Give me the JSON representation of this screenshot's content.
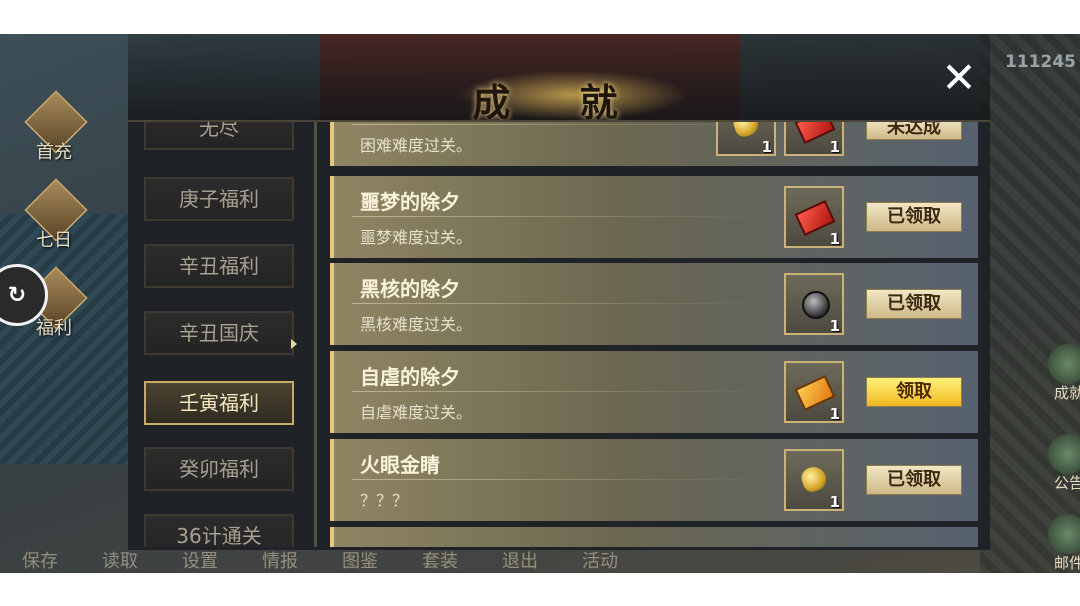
{
  "dialog": {
    "title": "成 就",
    "close_symbol": "✕"
  },
  "hud": {
    "counter": "111245"
  },
  "left_menu": [
    {
      "label": "首充"
    },
    {
      "label": "七日"
    },
    {
      "label": "福利"
    }
  ],
  "right_menu": [
    {
      "label": "成就"
    },
    {
      "label": "公告"
    },
    {
      "label": "邮件"
    }
  ],
  "bottom_bar": [
    "保存",
    "读取",
    "设置",
    "情报",
    "图鉴",
    "套装",
    "退出",
    "活动"
  ],
  "tabs": [
    {
      "label": "无尽",
      "active": false
    },
    {
      "label": "庚子福利",
      "active": false
    },
    {
      "label": "辛丑福利",
      "active": false
    },
    {
      "label": "辛丑国庆",
      "active": false
    },
    {
      "label": "壬寅福利",
      "active": true
    },
    {
      "label": "癸卯福利",
      "active": false
    },
    {
      "label": "36计通关",
      "active": false
    }
  ],
  "achievements": [
    {
      "name": "",
      "desc": "困难难度过关。",
      "items": [
        {
          "icon": "gold-ingot-icon",
          "qty": "1"
        },
        {
          "icon": "red-book-icon",
          "qty": "1"
        }
      ],
      "button": "未达成",
      "state": "unfinished"
    },
    {
      "name": "噩梦的除夕",
      "desc": "噩梦难度过关。",
      "items": [
        {
          "icon": "red-book-icon",
          "qty": "1"
        }
      ],
      "button": "已领取",
      "state": "claimed"
    },
    {
      "name": "黑核的除夕",
      "desc": "黑核难度过关。",
      "items": [
        {
          "icon": "black-orb-icon",
          "qty": "1"
        }
      ],
      "button": "已领取",
      "state": "claimed"
    },
    {
      "name": "自虐的除夕",
      "desc": "自虐难度过关。",
      "items": [
        {
          "icon": "orange-book-icon",
          "qty": "1"
        }
      ],
      "button": "领取",
      "state": "claimable"
    },
    {
      "name": "火眼金睛",
      "desc": "？？？",
      "items": [
        {
          "icon": "gold-ingot-icon",
          "qty": "1"
        }
      ],
      "button": "已领取",
      "state": "claimed"
    }
  ],
  "colors": {
    "accent_gold": "#e8c878",
    "claim_button": "#f0b820"
  }
}
